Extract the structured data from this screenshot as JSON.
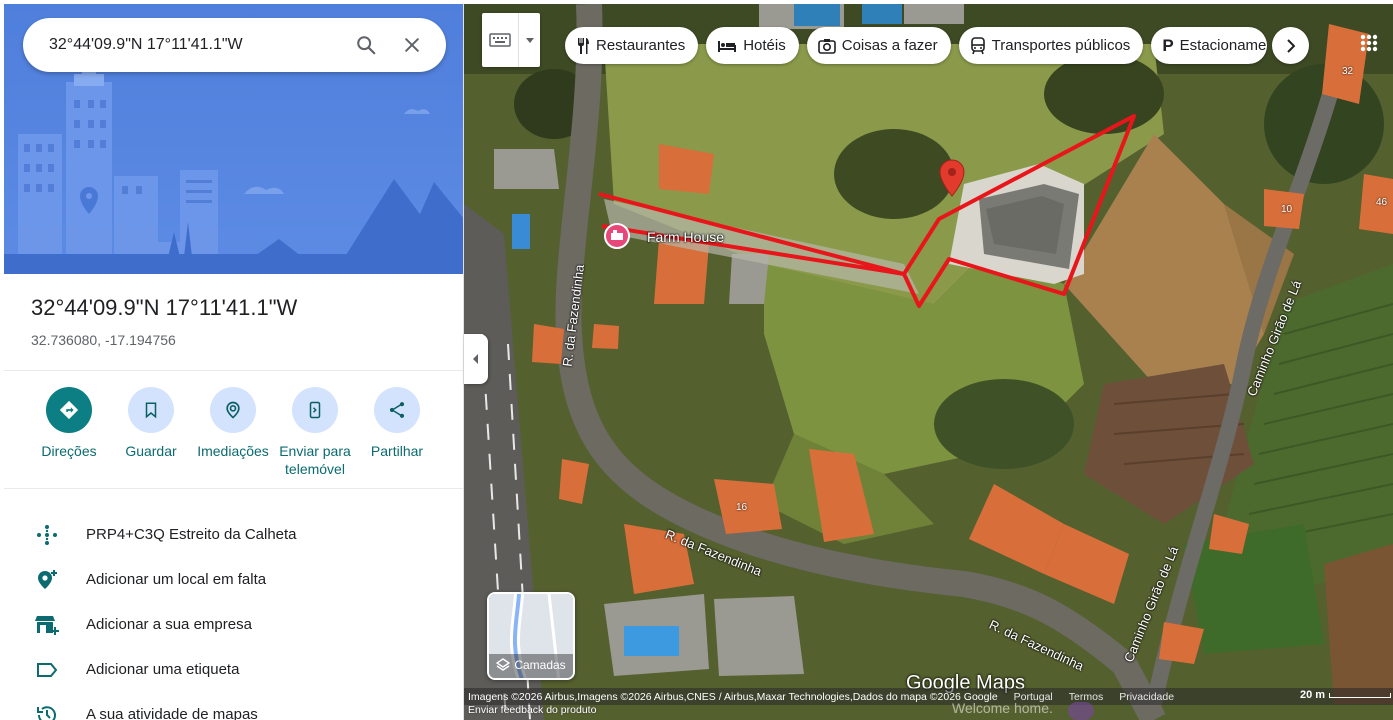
{
  "search": {
    "value": "32°44'09.9\"N 17°11'41.1\"W"
  },
  "place": {
    "title": "32°44'09.9\"N 17°11'41.1\"W",
    "decimal": "32.736080, -17.194756"
  },
  "actions": [
    {
      "label": "Direções",
      "icon": "directions-icon"
    },
    {
      "label": "Guardar",
      "icon": "bookmark-icon"
    },
    {
      "label": "Imediações",
      "icon": "nearby-icon"
    },
    {
      "label": "Enviar para telemóvel",
      "icon": "send-to-phone-icon"
    },
    {
      "label": "Partilhar",
      "icon": "share-icon"
    }
  ],
  "info_rows": [
    {
      "text": "PRP4+C3Q Estreito da Calheta",
      "icon": "plus-code-icon"
    },
    {
      "text": "Adicionar um local em falta",
      "icon": "add-place-icon"
    },
    {
      "text": "Adicionar a sua empresa",
      "icon": "add-business-icon"
    },
    {
      "text": "Adicionar uma etiqueta",
      "icon": "label-icon"
    },
    {
      "text": "A sua atividade de mapas",
      "icon": "history-icon"
    }
  ],
  "chips": [
    {
      "label": "Restaurantes",
      "icon": "restaurant-icon"
    },
    {
      "label": "Hotéis",
      "icon": "hotel-icon"
    },
    {
      "label": "Coisas a fazer",
      "icon": "camera-icon"
    },
    {
      "label": "Transportes públicos",
      "icon": "transit-icon"
    },
    {
      "label": "Estacionamento",
      "icon": "parking-icon"
    }
  ],
  "map": {
    "place_marker_label": "Farm House",
    "streets": [
      "R. da Fazendinha",
      "R. da Fazendinha",
      "R. da Fazendinha",
      "Caminho Girão de Lá",
      "Caminho Girão de Lá"
    ],
    "house_numbers": [
      "32",
      "10",
      "46",
      "16"
    ],
    "layers_label": "Camadas",
    "logo": "Google Maps",
    "attribution": "Imagens ©2026 Airbus,Imagens ©2026 Airbus,CNES / Airbus,Maxar Technologies,Dados do mapa ©2026 Google",
    "links": [
      "Portugal",
      "Termos",
      "Privacidade"
    ],
    "scale_label": "20 m",
    "feedback": "Enviar feedback do produto",
    "welcome": "Welcome home.",
    "boundary_color": "#e8161b",
    "pin_color": "#e23b2e",
    "marker_color": "#e8477a"
  }
}
